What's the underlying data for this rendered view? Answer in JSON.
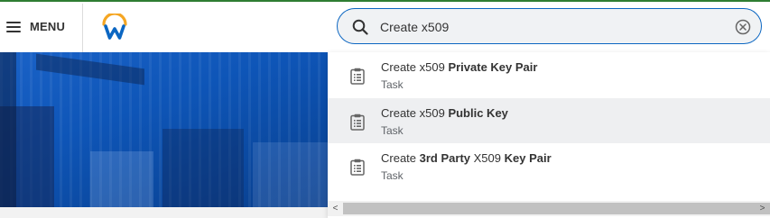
{
  "header": {
    "menu_label": "MENU",
    "menu_icon": "hamburger-icon",
    "logo_icon": "workday-logo",
    "brand_colors": {
      "blue": "#0b66c2",
      "orange": "#f5a623"
    }
  },
  "search": {
    "value": "Create x509",
    "search_icon": "search-icon",
    "clear_icon": "clear-circle-icon",
    "border_color": "#0b66c2"
  },
  "results": [
    {
      "prefix": "Create x509 ",
      "bold": "Private Key Pair",
      "tail": "",
      "type": "Task",
      "icon": "clipboard-icon",
      "highlighted": false
    },
    {
      "prefix": "Create x509 ",
      "bold": "Public Key",
      "tail": "",
      "type": "Task",
      "icon": "clipboard-icon",
      "highlighted": true
    },
    {
      "prefix": "Create ",
      "bold": "3rd Party",
      "mid": " X509 ",
      "bold2": "Key Pair",
      "type": "Task",
      "icon": "clipboard-icon",
      "highlighted": false
    }
  ],
  "scrollbar": {
    "left_arrow": "<",
    "right_arrow": ">"
  }
}
